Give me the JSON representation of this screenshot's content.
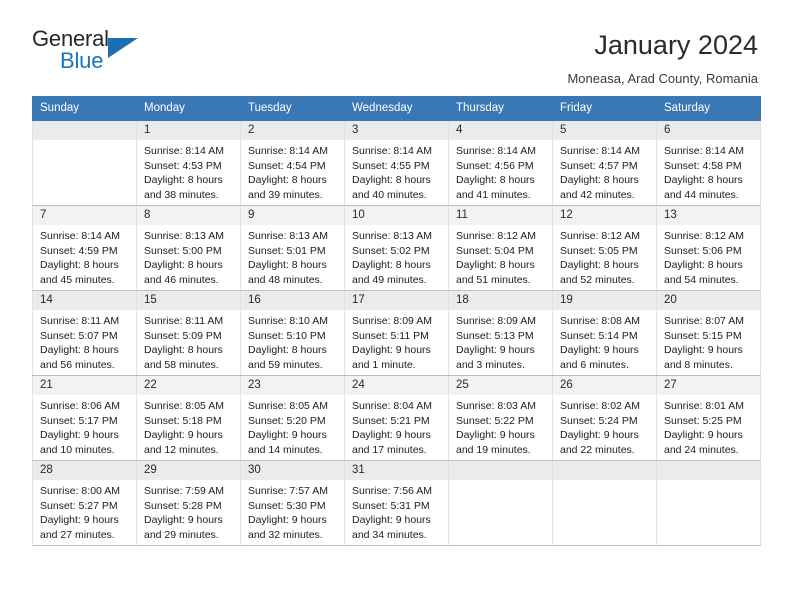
{
  "brand": {
    "name_top": "General",
    "name_bottom": "Blue",
    "triangle_icon": "triangle-icon",
    "accent_color": "#1b76bc"
  },
  "header": {
    "title": "January 2024",
    "location": "Moneasa, Arad County, Romania"
  },
  "calendar": {
    "header_background": "#3a78b5",
    "weekday_headers": [
      "Sunday",
      "Monday",
      "Tuesday",
      "Wednesday",
      "Thursday",
      "Friday",
      "Saturday"
    ],
    "weeks": [
      [
        {
          "day": "",
          "lines": []
        },
        {
          "day": "1",
          "lines": [
            "Sunrise: 8:14 AM",
            "Sunset: 4:53 PM",
            "Daylight: 8 hours",
            "and 38 minutes."
          ]
        },
        {
          "day": "2",
          "lines": [
            "Sunrise: 8:14 AM",
            "Sunset: 4:54 PM",
            "Daylight: 8 hours",
            "and 39 minutes."
          ]
        },
        {
          "day": "3",
          "lines": [
            "Sunrise: 8:14 AM",
            "Sunset: 4:55 PM",
            "Daylight: 8 hours",
            "and 40 minutes."
          ]
        },
        {
          "day": "4",
          "lines": [
            "Sunrise: 8:14 AM",
            "Sunset: 4:56 PM",
            "Daylight: 8 hours",
            "and 41 minutes."
          ]
        },
        {
          "day": "5",
          "lines": [
            "Sunrise: 8:14 AM",
            "Sunset: 4:57 PM",
            "Daylight: 8 hours",
            "and 42 minutes."
          ]
        },
        {
          "day": "6",
          "lines": [
            "Sunrise: 8:14 AM",
            "Sunset: 4:58 PM",
            "Daylight: 8 hours",
            "and 44 minutes."
          ]
        }
      ],
      [
        {
          "day": "7",
          "lines": [
            "Sunrise: 8:14 AM",
            "Sunset: 4:59 PM",
            "Daylight: 8 hours",
            "and 45 minutes."
          ]
        },
        {
          "day": "8",
          "lines": [
            "Sunrise: 8:13 AM",
            "Sunset: 5:00 PM",
            "Daylight: 8 hours",
            "and 46 minutes."
          ]
        },
        {
          "day": "9",
          "lines": [
            "Sunrise: 8:13 AM",
            "Sunset: 5:01 PM",
            "Daylight: 8 hours",
            "and 48 minutes."
          ]
        },
        {
          "day": "10",
          "lines": [
            "Sunrise: 8:13 AM",
            "Sunset: 5:02 PM",
            "Daylight: 8 hours",
            "and 49 minutes."
          ]
        },
        {
          "day": "11",
          "lines": [
            "Sunrise: 8:12 AM",
            "Sunset: 5:04 PM",
            "Daylight: 8 hours",
            "and 51 minutes."
          ]
        },
        {
          "day": "12",
          "lines": [
            "Sunrise: 8:12 AM",
            "Sunset: 5:05 PM",
            "Daylight: 8 hours",
            "and 52 minutes."
          ]
        },
        {
          "day": "13",
          "lines": [
            "Sunrise: 8:12 AM",
            "Sunset: 5:06 PM",
            "Daylight: 8 hours",
            "and 54 minutes."
          ]
        }
      ],
      [
        {
          "day": "14",
          "lines": [
            "Sunrise: 8:11 AM",
            "Sunset: 5:07 PM",
            "Daylight: 8 hours",
            "and 56 minutes."
          ]
        },
        {
          "day": "15",
          "lines": [
            "Sunrise: 8:11 AM",
            "Sunset: 5:09 PM",
            "Daylight: 8 hours",
            "and 58 minutes."
          ]
        },
        {
          "day": "16",
          "lines": [
            "Sunrise: 8:10 AM",
            "Sunset: 5:10 PM",
            "Daylight: 8 hours",
            "and 59 minutes."
          ]
        },
        {
          "day": "17",
          "lines": [
            "Sunrise: 8:09 AM",
            "Sunset: 5:11 PM",
            "Daylight: 9 hours",
            "and 1 minute."
          ]
        },
        {
          "day": "18",
          "lines": [
            "Sunrise: 8:09 AM",
            "Sunset: 5:13 PM",
            "Daylight: 9 hours",
            "and 3 minutes."
          ]
        },
        {
          "day": "19",
          "lines": [
            "Sunrise: 8:08 AM",
            "Sunset: 5:14 PM",
            "Daylight: 9 hours",
            "and 6 minutes."
          ]
        },
        {
          "day": "20",
          "lines": [
            "Sunrise: 8:07 AM",
            "Sunset: 5:15 PM",
            "Daylight: 9 hours",
            "and 8 minutes."
          ]
        }
      ],
      [
        {
          "day": "21",
          "lines": [
            "Sunrise: 8:06 AM",
            "Sunset: 5:17 PM",
            "Daylight: 9 hours",
            "and 10 minutes."
          ]
        },
        {
          "day": "22",
          "lines": [
            "Sunrise: 8:05 AM",
            "Sunset: 5:18 PM",
            "Daylight: 9 hours",
            "and 12 minutes."
          ]
        },
        {
          "day": "23",
          "lines": [
            "Sunrise: 8:05 AM",
            "Sunset: 5:20 PM",
            "Daylight: 9 hours",
            "and 14 minutes."
          ]
        },
        {
          "day": "24",
          "lines": [
            "Sunrise: 8:04 AM",
            "Sunset: 5:21 PM",
            "Daylight: 9 hours",
            "and 17 minutes."
          ]
        },
        {
          "day": "25",
          "lines": [
            "Sunrise: 8:03 AM",
            "Sunset: 5:22 PM",
            "Daylight: 9 hours",
            "and 19 minutes."
          ]
        },
        {
          "day": "26",
          "lines": [
            "Sunrise: 8:02 AM",
            "Sunset: 5:24 PM",
            "Daylight: 9 hours",
            "and 22 minutes."
          ]
        },
        {
          "day": "27",
          "lines": [
            "Sunrise: 8:01 AM",
            "Sunset: 5:25 PM",
            "Daylight: 9 hours",
            "and 24 minutes."
          ]
        }
      ],
      [
        {
          "day": "28",
          "lines": [
            "Sunrise: 8:00 AM",
            "Sunset: 5:27 PM",
            "Daylight: 9 hours",
            "and 27 minutes."
          ]
        },
        {
          "day": "29",
          "lines": [
            "Sunrise: 7:59 AM",
            "Sunset: 5:28 PM",
            "Daylight: 9 hours",
            "and 29 minutes."
          ]
        },
        {
          "day": "30",
          "lines": [
            "Sunrise: 7:57 AM",
            "Sunset: 5:30 PM",
            "Daylight: 9 hours",
            "and 32 minutes."
          ]
        },
        {
          "day": "31",
          "lines": [
            "Sunrise: 7:56 AM",
            "Sunset: 5:31 PM",
            "Daylight: 9 hours",
            "and 34 minutes."
          ]
        },
        {
          "day": "",
          "lines": []
        },
        {
          "day": "",
          "lines": []
        },
        {
          "day": "",
          "lines": []
        }
      ]
    ]
  }
}
